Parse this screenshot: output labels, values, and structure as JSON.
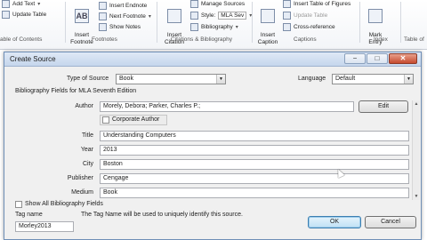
{
  "ribbon": {
    "footnotes": {
      "add_text": "Add Text",
      "update_table": "Update Table",
      "toc_label": "able of Contents",
      "insert_footnote": "Insert\nFootnote",
      "insert_endnote": "Insert Endnote",
      "next_footnote": "Next Footnote",
      "show_notes": "Show Notes",
      "group_label": "Footnotes",
      "ab_glyph": "AB"
    },
    "citations": {
      "insert_citation": "Insert\nCitation",
      "manage_sources": "Manage Sources",
      "style_label": "Style:",
      "style_value": "MLA Sev",
      "bibliography": "Bibliography",
      "group_label": "Citations & Bibliography"
    },
    "captions": {
      "insert_caption": "Insert\nCaption",
      "insert_table_of_figures": "Insert Table of Figures",
      "update_table": "Update Table",
      "cross_reference": "Cross-reference",
      "group_label": "Captions"
    },
    "index": {
      "mark_entry": "Mark\nEntry",
      "group_label": "Index"
    },
    "toa": {
      "group_label": "Table of"
    }
  },
  "dialog": {
    "title": "Create Source",
    "minimize": "−",
    "maximize": "□",
    "close": "✕",
    "type_of_source_label": "Type of Source",
    "type_of_source_value": "Book",
    "language_label": "Language",
    "language_value": "Default",
    "section_heading": "Bibliography Fields for MLA Seventh Edition",
    "fields": {
      "author_label": "Author",
      "author_value": "Morely, Debora; Parker, Charles P.;",
      "edit_button": "Edit",
      "corporate_author_label": "Corporate Author",
      "title_label": "Title",
      "title_value": "Understanding Computers",
      "year_label": "Year",
      "year_value": "2013",
      "city_label": "City",
      "city_value": "Boston",
      "publisher_label": "Publisher",
      "publisher_value": "Cengage",
      "medium_label": "Medium",
      "medium_value": "Book"
    },
    "show_all_label": "Show All Bibliography Fields",
    "tag_name_label": "Tag name",
    "tag_name_value": "Morley2013",
    "tag_hint": "The Tag Name will be used to uniquely identify this source.",
    "ok_button": "OK",
    "cancel_button": "Cancel"
  },
  "colors": {
    "accent_title": "#c5d6ec",
    "default_button": "#bfe0f5",
    "close_button": "#c64a2e"
  }
}
